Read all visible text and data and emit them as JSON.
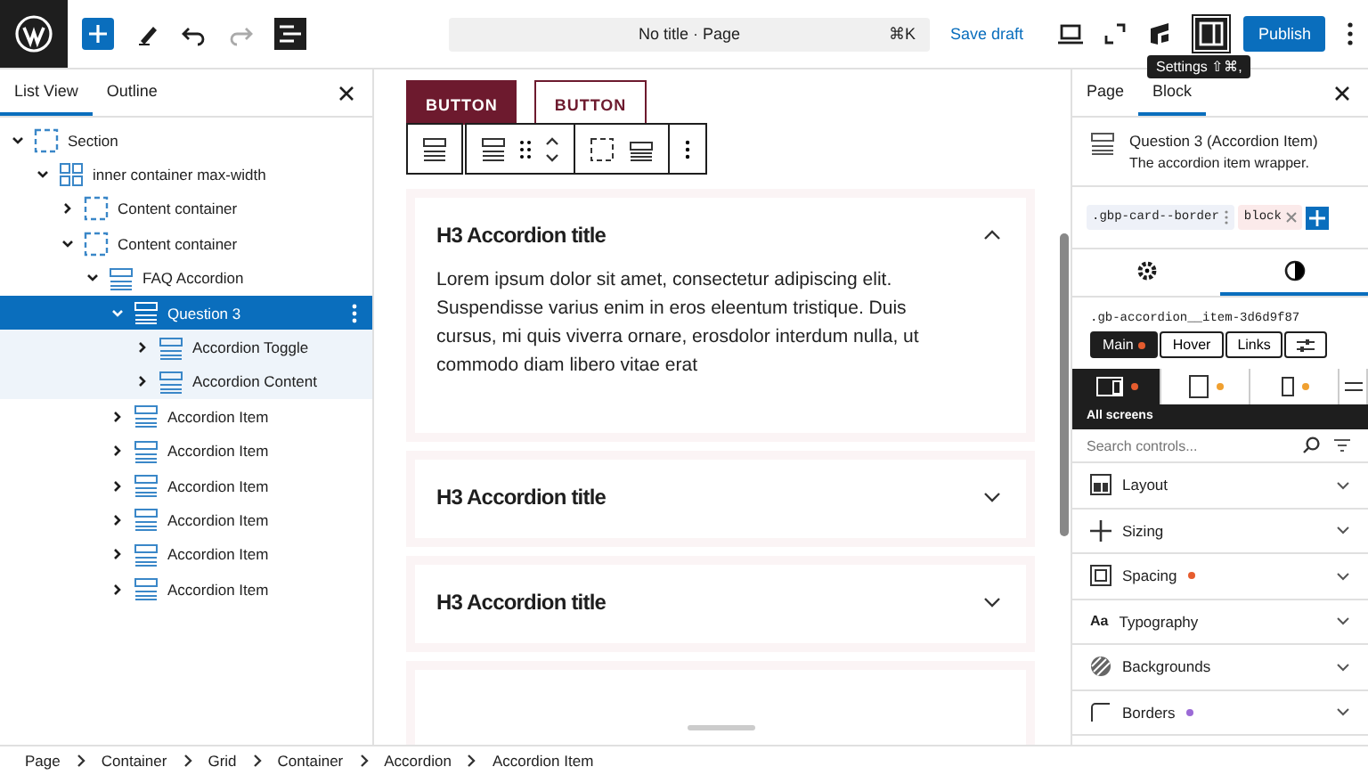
{
  "topbar": {
    "document_title": "No title · Page",
    "shortcut": "⌘K",
    "save_draft": "Save draft",
    "publish": "Publish",
    "tooltip": "Settings ⇧⌘,"
  },
  "left_panel": {
    "tabs": [
      {
        "label": "List View",
        "selected": true
      },
      {
        "label": "Outline",
        "selected": false
      }
    ],
    "tree": [
      {
        "label": "Section",
        "kind": "container",
        "expanded": true,
        "selected": false,
        "children": [
          {
            "label": "inner container max-width",
            "kind": "grid",
            "expanded": true,
            "selected": false,
            "children": [
              {
                "label": "Content container",
                "kind": "container",
                "expanded": false,
                "selected": false
              },
              {
                "label": "Content container",
                "kind": "container",
                "expanded": true,
                "selected": false,
                "children": [
                  {
                    "label": "FAQ Accordion",
                    "kind": "accordion",
                    "expanded": true,
                    "selected": false,
                    "children": [
                      {
                        "label": "Question 3",
                        "kind": "accordion",
                        "expanded": true,
                        "selected": true,
                        "children": [
                          {
                            "label": "Accordion Toggle",
                            "kind": "accordion",
                            "expanded": false,
                            "selected": false
                          },
                          {
                            "label": "Accordion Content",
                            "kind": "accordion",
                            "expanded": false,
                            "selected": false
                          }
                        ]
                      },
                      {
                        "label": "Accordion Item",
                        "kind": "accordion",
                        "expanded": false,
                        "selected": false
                      },
                      {
                        "label": "Accordion Item",
                        "kind": "accordion",
                        "expanded": false,
                        "selected": false
                      },
                      {
                        "label": "Accordion Item",
                        "kind": "accordion",
                        "expanded": false,
                        "selected": false
                      },
                      {
                        "label": "Accordion Item",
                        "kind": "accordion",
                        "expanded": false,
                        "selected": false
                      },
                      {
                        "label": "Accordion Item",
                        "kind": "accordion",
                        "expanded": false,
                        "selected": false
                      },
                      {
                        "label": "Accordion Item",
                        "kind": "accordion",
                        "expanded": false,
                        "selected": false
                      }
                    ]
                  }
                ]
              }
            ]
          }
        ]
      }
    ]
  },
  "canvas": {
    "buttons": [
      {
        "label": "BUTTON",
        "kind": "filled"
      },
      {
        "label": "BUTTON",
        "kind": "outline"
      }
    ],
    "accordion": [
      {
        "title": "H3 Accordion title",
        "expanded": true,
        "body": "Lorem ipsum dolor sit amet, consectetur adipiscing elit. Suspendisse varius enim in eros eleentum tristique. Duis cursus, mi quis viverra ornare, erosdolor interdum nulla, ut commodo diam libero vitae erat"
      },
      {
        "title": "H3 Accordion title",
        "expanded": false
      },
      {
        "title": "H3 Accordion title",
        "expanded": false
      }
    ]
  },
  "right_panel": {
    "tabs": [
      {
        "label": "Page",
        "selected": false
      },
      {
        "label": "Block",
        "selected": true
      }
    ],
    "block_title": "Question 3 (Accordion Item)",
    "block_description": "The accordion item wrapper.",
    "classes": [
      {
        "label": ".gbp-card--border",
        "kind": "global"
      },
      {
        "label": "block",
        "kind": "local"
      }
    ],
    "panel_tabs": [
      {
        "kind": "gear",
        "selected": false
      },
      {
        "kind": "contrast",
        "selected": true
      }
    ],
    "selector": ".gb-accordion__item-3d6d9f87",
    "states": [
      {
        "label": "Main",
        "selected": true,
        "color": "#e65c2e"
      },
      {
        "label": "Hover",
        "selected": false
      },
      {
        "label": "Links",
        "selected": false
      }
    ],
    "devices": [
      {
        "kind": "desktop",
        "selected": true,
        "color": "#e65c2e"
      },
      {
        "kind": "tablet",
        "selected": false,
        "color": "#f0a030"
      },
      {
        "kind": "mobile",
        "selected": false,
        "color": "#f0a030"
      }
    ],
    "device_label": "All screens",
    "search": {
      "placeholder": "Search controls..."
    },
    "sections": [
      {
        "label": "Layout",
        "kind": "layout"
      },
      {
        "label": "Sizing",
        "kind": "sizing"
      },
      {
        "label": "Spacing",
        "kind": "spacing",
        "color": "#e65c2e"
      },
      {
        "label": "Typography",
        "kind": "typography",
        "glyph": "Aa"
      },
      {
        "label": "Backgrounds",
        "kind": "backgrounds"
      },
      {
        "label": "Borders",
        "kind": "borders",
        "color": "#9b6ad6"
      }
    ]
  },
  "breadcrumbs": [
    "Page",
    "Container",
    "Grid",
    "Container",
    "Accordion",
    "Accordion Item"
  ]
}
